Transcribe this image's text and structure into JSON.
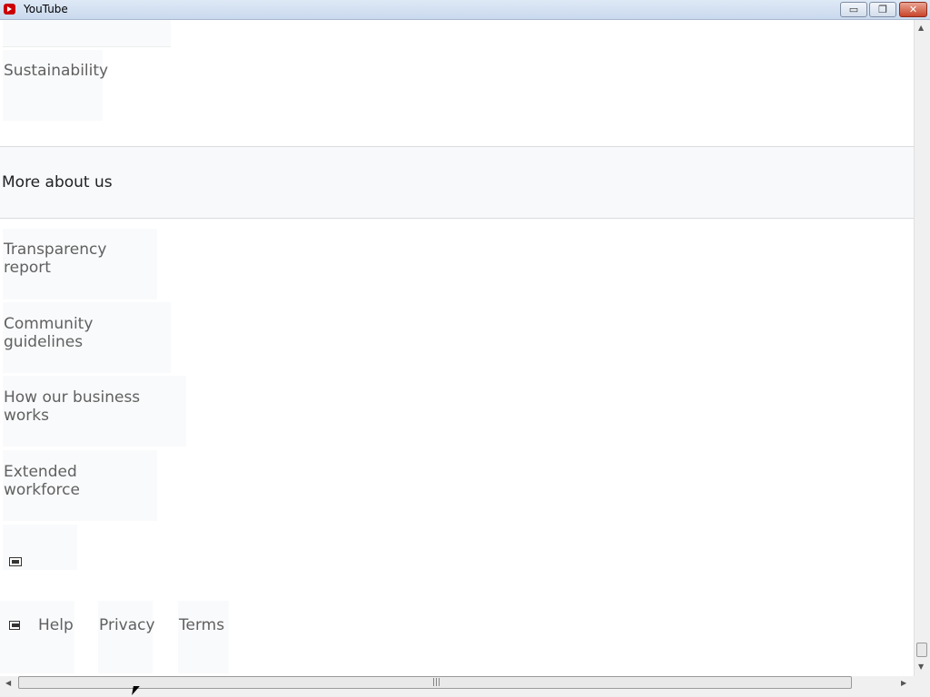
{
  "window": {
    "title": "YouTube"
  },
  "links_top": {
    "sustainability": "Sustainability"
  },
  "section": {
    "title": "More about us"
  },
  "links": [
    "Transparency report",
    "Community guidelines",
    "How our business works",
    "Extended workforce"
  ],
  "footer": {
    "help": "Help",
    "privacy": "Privacy",
    "terms": "Terms"
  },
  "titlebar_controls": {
    "minimize": "▭",
    "restore": "❐",
    "close": "✕"
  },
  "icons": {
    "app": "youtube-icon",
    "image": "broken-image-icon"
  }
}
